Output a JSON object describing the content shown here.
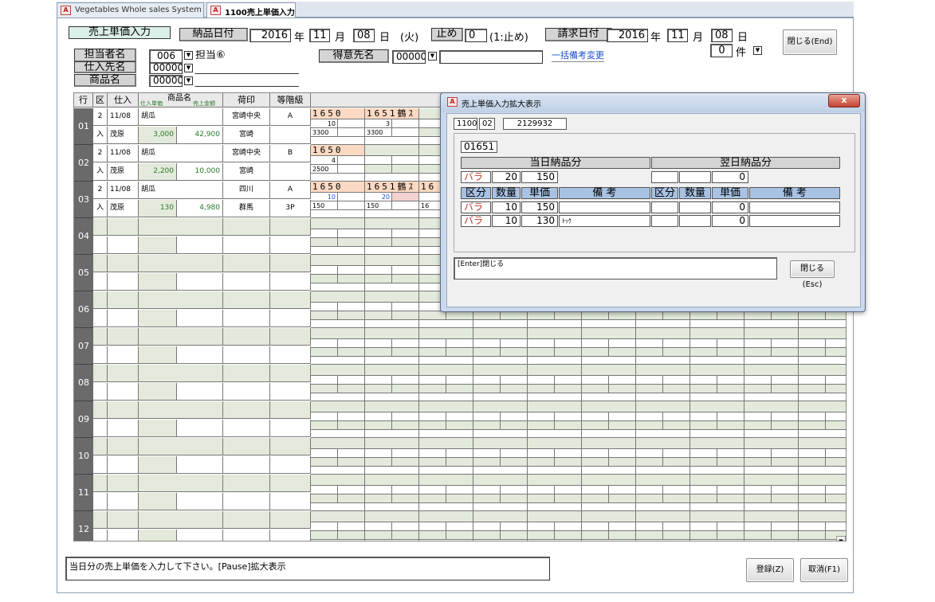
{
  "tabs": [
    {
      "label": "Vegetables Whole sales System"
    },
    {
      "label": "1100売上単価入力"
    }
  ],
  "header": {
    "title_label": "売上単価入力",
    "delivery_date_label": "納品日付",
    "year": "2016",
    "year_unit": "年",
    "month": "11",
    "month_unit": "月",
    "day": "08",
    "day_unit": "日",
    "weekday": "(火)",
    "stop_label": "止め",
    "stop_value": "0",
    "stop_hint": "(1:止め)",
    "billing_date_label": "請求日付",
    "bill_year": "2016",
    "bill_month": "11",
    "bill_day": "08",
    "count_value": "0",
    "count_unit": "件",
    "close_button": "閉じる(End)",
    "person_label": "担当者名",
    "person_code": "006",
    "person_name": "担当⑥",
    "customer_label": "得意先名",
    "customer_code": "00000",
    "customer_name": "",
    "bulk_link": "一括備考変更",
    "supplier_label": "仕入先名",
    "supplier_code": "00000",
    "product_label": "商品名",
    "product_code": "00000"
  },
  "grid": {
    "headers": {
      "gyo": "行",
      "ku": "区",
      "shiire": "仕入",
      "shiire_tanka": "仕入単価",
      "shohin": "商品名",
      "uriage": "売上金額",
      "nijirushi": "荷印",
      "tokai": "等階級"
    },
    "rows": [
      {
        "no": "01",
        "ku1": "2",
        "date": "11/08",
        "product": "胡瓜",
        "mark": "宮崎中央",
        "grade": "A",
        "ku2": "入",
        "supplier": "茂原",
        "price": "3,000",
        "amount": "42,900",
        "mark2": "宮崎",
        "grade2": "",
        "blocks": [
          {
            "code": "1650",
            "qty": "10",
            "val": "3300"
          },
          {
            "code": "1651鶴ｽ",
            "qty": "3",
            "val": "3300"
          }
        ]
      },
      {
        "no": "02",
        "ku1": "2",
        "date": "11/08",
        "product": "胡瓜",
        "mark": "宮崎中央",
        "grade": "B",
        "ku2": "入",
        "supplier": "茂原",
        "price": "2,200",
        "amount": "10,000",
        "mark2": "宮崎",
        "grade2": "",
        "blocks": [
          {
            "code": "1650",
            "qty": "4",
            "val": "2500"
          }
        ]
      },
      {
        "no": "03",
        "ku1": "2",
        "date": "11/08",
        "product": "胡瓜",
        "mark": "四川",
        "grade": "A",
        "ku2": "入",
        "supplier": "茂原",
        "price": "130",
        "amount": "4,980",
        "mark2": "群馬",
        "grade2": "3P",
        "blocks": [
          {
            "code": "1650",
            "prefix": "B",
            "qty": "10",
            "val": "150"
          },
          {
            "code": "1651鶴ｽ",
            "prefix": "B",
            "qty": "20",
            "val": "150"
          },
          {
            "code": "16",
            "prefix": "B",
            "qty": "",
            "val": "16"
          }
        ]
      },
      {
        "no": "04"
      },
      {
        "no": "05"
      },
      {
        "no": "06"
      },
      {
        "no": "07"
      },
      {
        "no": "08"
      },
      {
        "no": "09"
      },
      {
        "no": "10"
      },
      {
        "no": "11"
      },
      {
        "no": "12"
      }
    ]
  },
  "status": {
    "message": "当日分の売上単価を入力して下さい。[Pause]拡大表示"
  },
  "buttons": {
    "register": "登録(Z)",
    "cancel": "取消(F1)"
  },
  "dialog": {
    "title": "売上単価入力拡大表示",
    "close_x": "x",
    "code1": "1100",
    "code2": "02",
    "code3": "2129932",
    "item_code": "01651",
    "today_label": "当日納品分",
    "next_label": "翌日納品分",
    "summary": {
      "kind": "バラ",
      "qty": "20",
      "price": "150",
      "next_price": "0"
    },
    "cols": {
      "kubun": "区分",
      "suryo": "数量",
      "tanka": "単価",
      "biko": "備 考"
    },
    "rows": [
      {
        "kind": "バラ",
        "qty": "10",
        "price": "150",
        "note": "",
        "next_price": "0"
      },
      {
        "kind": "バラ",
        "qty": "10",
        "price": "130",
        "note": "ﾄｯｹ",
        "next_price": "0"
      }
    ],
    "hint": "[Enter]閉じる",
    "close_button": "閉じる(Esc)"
  }
}
